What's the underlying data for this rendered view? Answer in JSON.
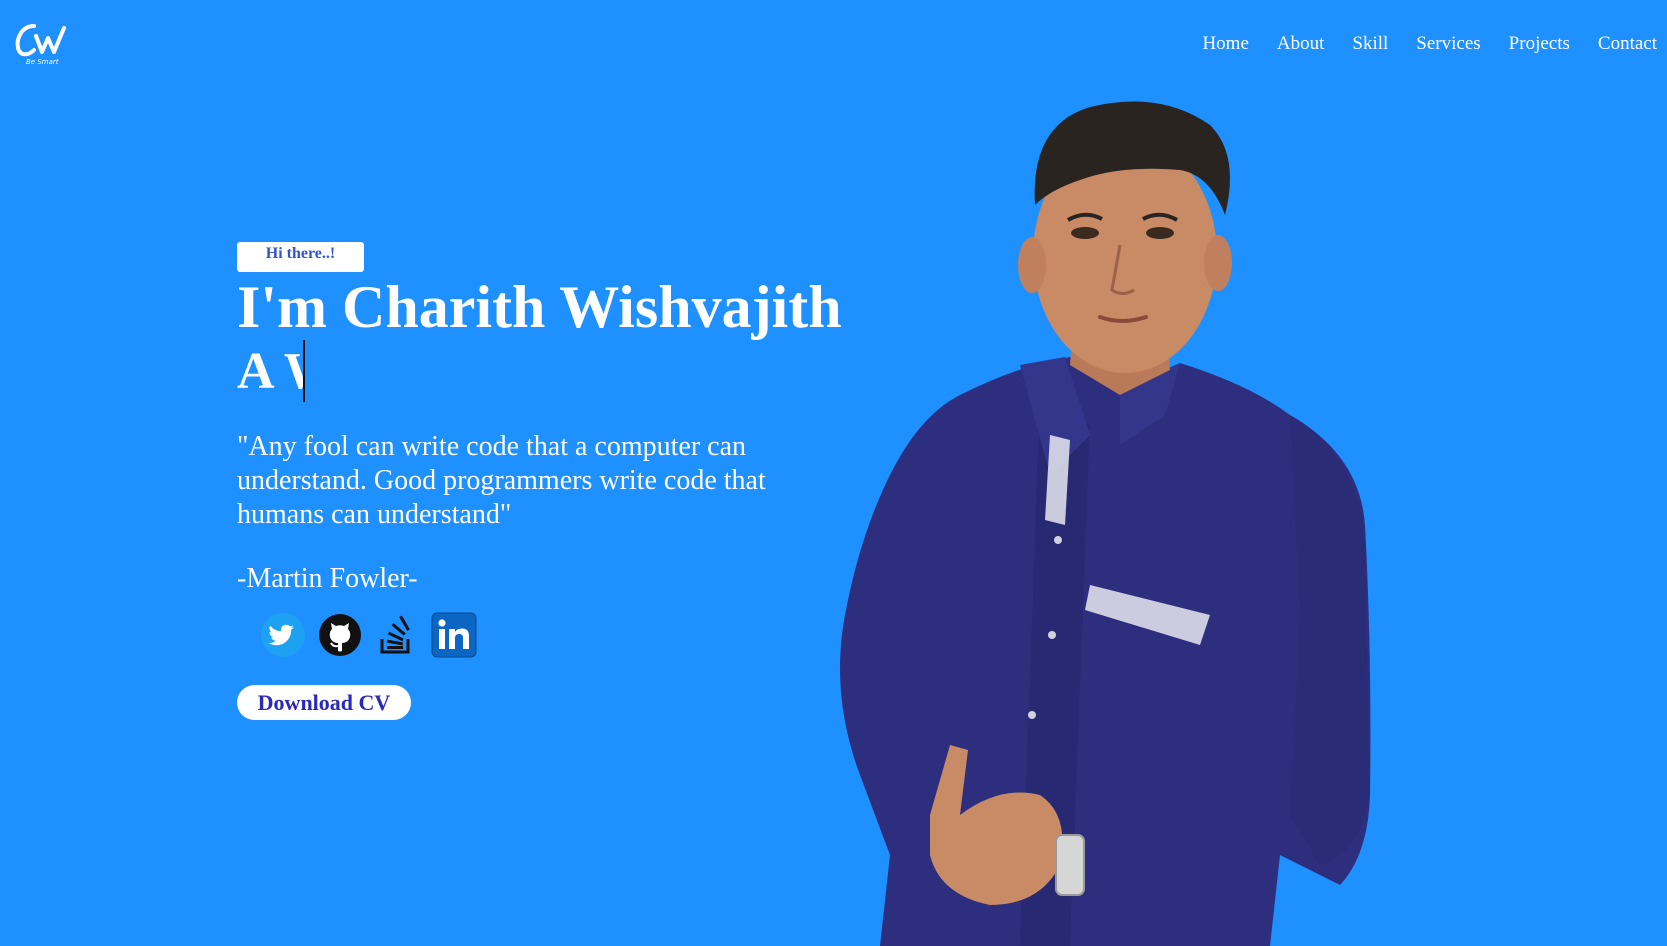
{
  "header": {
    "logo_text": "Cw",
    "logo_tagline": "Be Smart",
    "nav": [
      {
        "label": "Home"
      },
      {
        "label": "About"
      },
      {
        "label": "Skill"
      },
      {
        "label": "Services"
      },
      {
        "label": "Projects"
      },
      {
        "label": "Contact"
      }
    ]
  },
  "hero": {
    "greeting": "Hi there..!",
    "name": "I'm Charith Wishvajith",
    "typed_text": "A W",
    "quote": "\"Any fool can write code that a computer can understand. Good programmers write code that humans can understand\"",
    "author": "-Martin Fowler-",
    "socials": [
      {
        "icon": "twitter-icon"
      },
      {
        "icon": "github-icon"
      },
      {
        "icon": "stackoverflow-icon"
      },
      {
        "icon": "linkedin-icon"
      }
    ],
    "cta_label": "Download CV"
  },
  "colors": {
    "background": "#1e90ff",
    "text": "#ffffff",
    "greeting_text": "#3355cc",
    "cta_text": "#2a2ab8",
    "shirt": "#2d2f7e"
  }
}
